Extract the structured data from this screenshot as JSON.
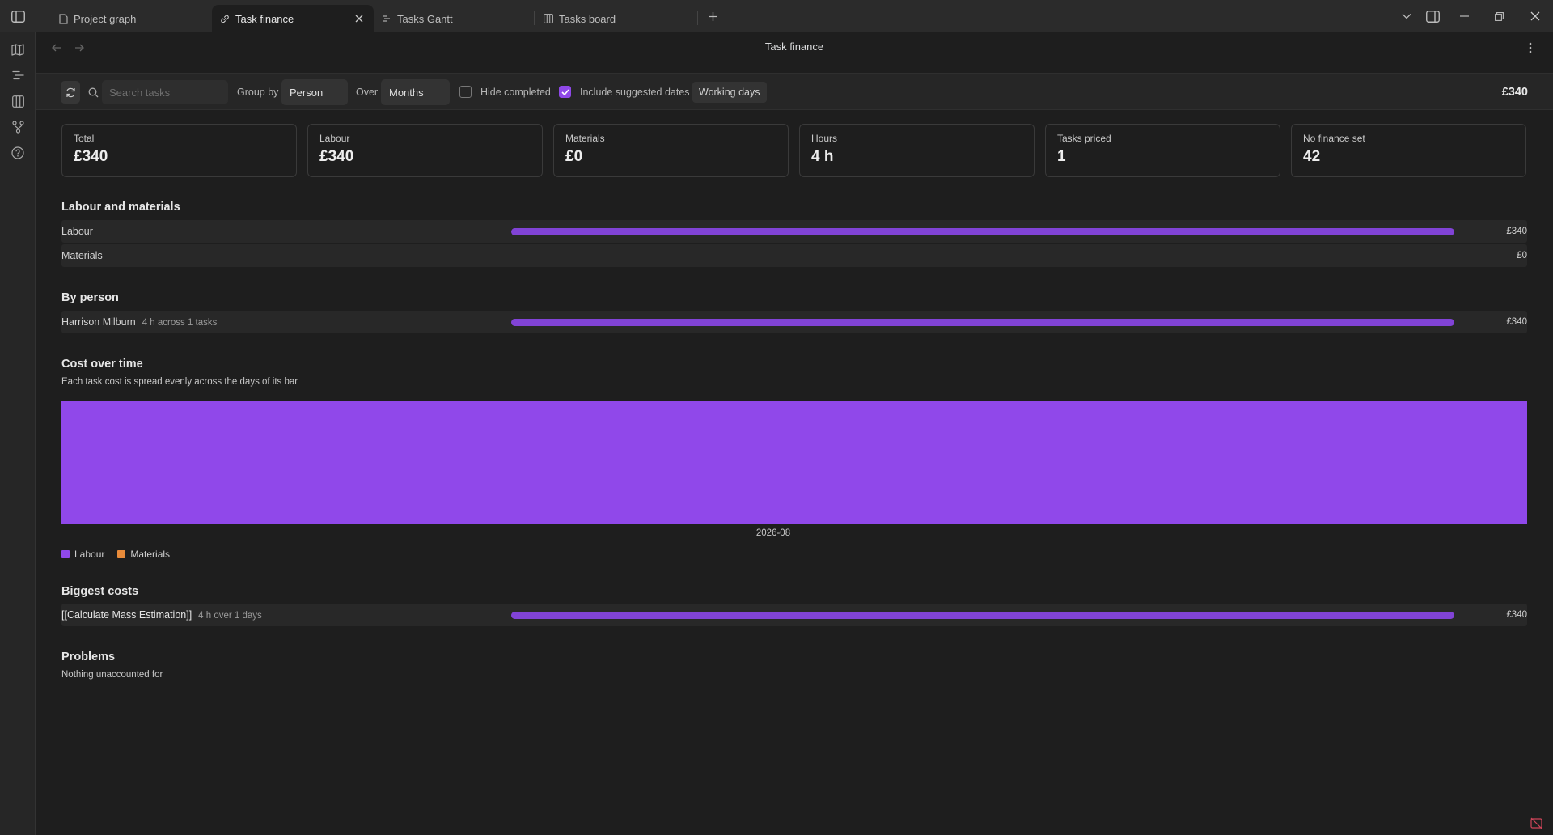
{
  "tabs": [
    {
      "label": "Project graph",
      "icon": "file-icon"
    },
    {
      "label": "Task finance",
      "icon": "link-icon",
      "active": true
    },
    {
      "label": "Tasks Gantt",
      "icon": "gantt-icon"
    },
    {
      "label": "Tasks board",
      "icon": "board-icon"
    }
  ],
  "view": {
    "title": "Task finance"
  },
  "toolbar": {
    "search_placeholder": "Search tasks",
    "group_by_label": "Group by",
    "group_by_value": "Person",
    "over_label": "Over",
    "over_value": "Months",
    "hide_completed_label": "Hide completed",
    "hide_completed_checked": false,
    "include_suggested_label": "Include suggested dates",
    "include_suggested_checked": true,
    "working_days_label": "Working days",
    "total": "£340"
  },
  "cards": [
    {
      "label": "Total",
      "value": "£340"
    },
    {
      "label": "Labour",
      "value": "£340"
    },
    {
      "label": "Materials",
      "value": "£0"
    },
    {
      "label": "Hours",
      "value": "4 h"
    },
    {
      "label": "Tasks priced",
      "value": "1"
    },
    {
      "label": "No finance set",
      "value": "42"
    }
  ],
  "labour_materials": {
    "title": "Labour and materials",
    "rows": [
      {
        "label": "Labour",
        "value": "£340",
        "fraction": 1.0
      },
      {
        "label": "Materials",
        "value": "£0",
        "fraction": 0
      }
    ]
  },
  "by_person": {
    "title": "By person",
    "rows": [
      {
        "label": "Harrison Milburn",
        "sub": "4 h across 1 tasks",
        "value": "£340",
        "fraction": 1.0
      }
    ]
  },
  "cost_over_time": {
    "title": "Cost over time",
    "note": "Each task cost is spread evenly across the days of its bar"
  },
  "chart_data": {
    "type": "bar",
    "categories": [
      "2026-08"
    ],
    "series": [
      {
        "name": "Labour",
        "values": [
          340
        ],
        "color": "#9048ea"
      },
      {
        "name": "Materials",
        "values": [
          0
        ],
        "color": "#e88b3a"
      }
    ],
    "stacked": true,
    "ylim": [
      0,
      340
    ]
  },
  "biggest_costs": {
    "title": "Biggest costs",
    "rows": [
      {
        "label": "[[Calculate Mass Estimation]]",
        "sub": "4 h over 1 days",
        "value": "£340",
        "fraction": 1.0
      }
    ]
  },
  "problems": {
    "title": "Problems",
    "note": "Nothing unaccounted for"
  },
  "colors": {
    "accent": "#8f48e8",
    "bar": "#8143d6",
    "materials": "#e88b3a"
  }
}
